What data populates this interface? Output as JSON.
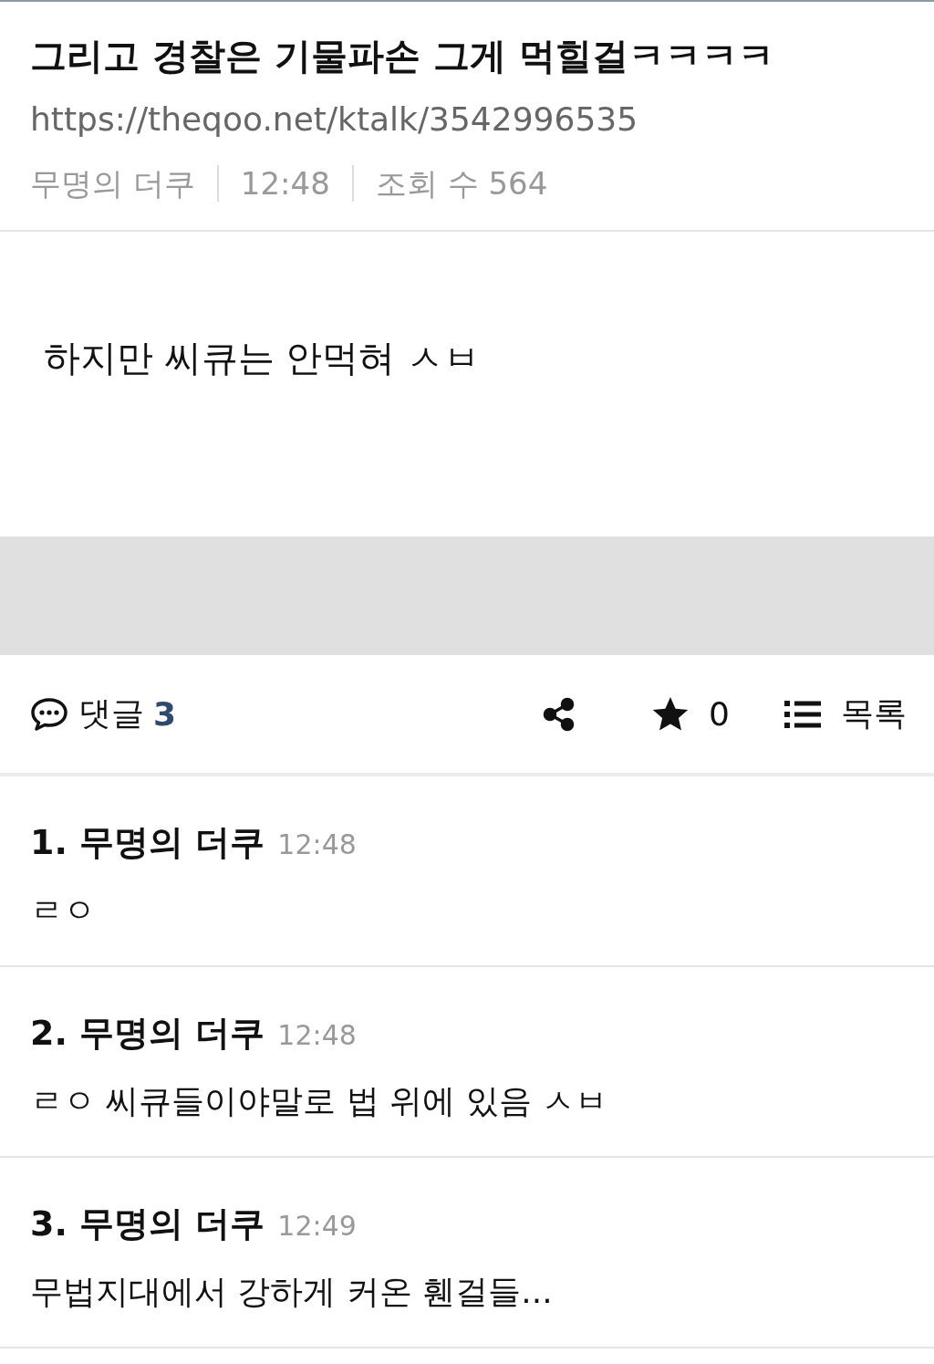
{
  "post": {
    "title": "그리고 경찰은 기물파손 그게 먹힐걸ㅋㅋㅋㅋ",
    "url": "https://theqoo.net/ktalk/3542996535",
    "author": "무명의 더쿠",
    "time": "12:48",
    "views": "조회 수 564"
  },
  "body": "하지만 씨큐는 안먹혀 ㅅㅂ",
  "toolbar": {
    "comments_label": "댓글",
    "comments_count": "3",
    "likes": "0",
    "list_label": "목록"
  },
  "comments": [
    {
      "number": "1.",
      "author": "무명의 더쿠",
      "time": "12:48",
      "text": "ㄹㅇ"
    },
    {
      "number": "2.",
      "author": "무명의 더쿠",
      "time": "12:48",
      "text": "ㄹㅇ 씨큐들이야말로 법 위에 있음 ㅅㅂ"
    },
    {
      "number": "3.",
      "author": "무명의 더쿠",
      "time": "12:49",
      "text": "무법지대에서 강하게 커온 휀걸들..."
    }
  ]
}
